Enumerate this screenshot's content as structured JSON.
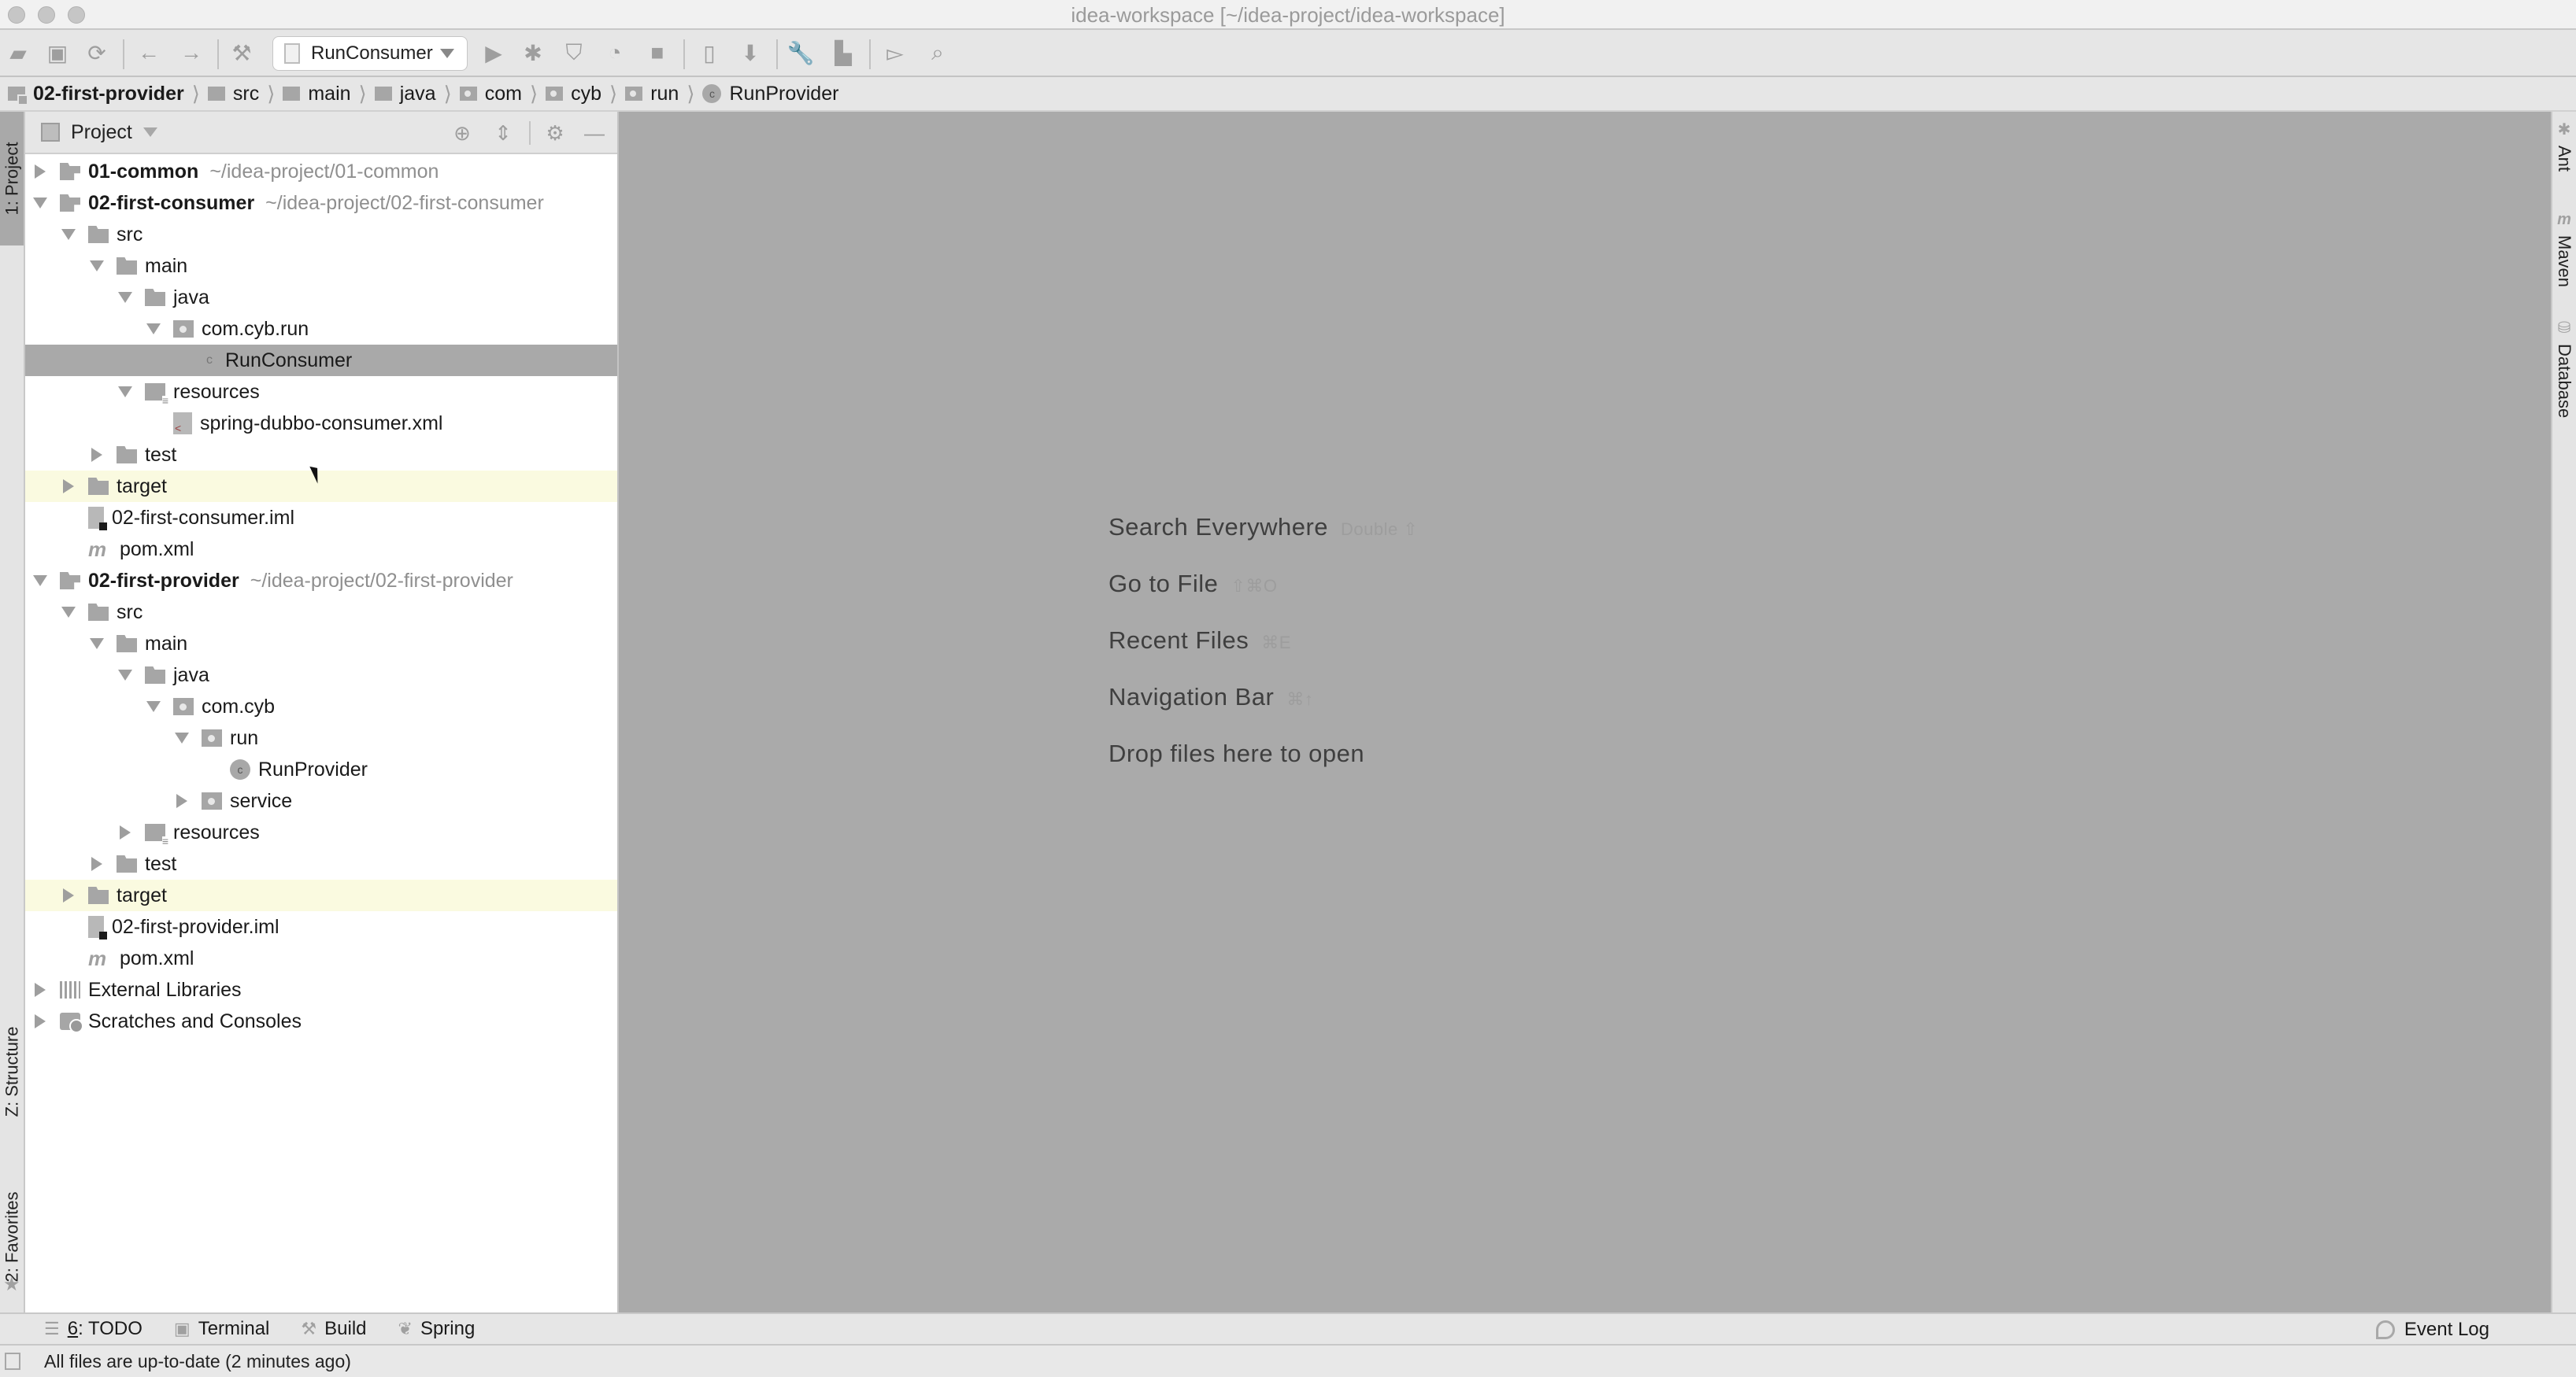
{
  "window": {
    "title": "idea-workspace [~/idea-project/idea-workspace]"
  },
  "toolbar": {
    "run_config": "RunConsumer",
    "icons": [
      "open-folder-icon",
      "save-icon",
      "sync-icon",
      "back-arrow-icon",
      "forward-arrow-icon",
      "build-hammer-icon",
      "run-icon",
      "debug-icon",
      "run-with-coverage-icon",
      "profile-icon",
      "stop-icon",
      "device-manager-icon",
      "sdk-manager-icon",
      "settings-wrench-icon",
      "project-structure-icon",
      "terminal-panel-icon",
      "search-icon"
    ]
  },
  "navbar": {
    "crumbs": [
      {
        "label": "02-first-provider",
        "icon": "module-folder-icon"
      },
      {
        "label": "src",
        "icon": "folder-icon"
      },
      {
        "label": "main",
        "icon": "folder-icon"
      },
      {
        "label": "java",
        "icon": "folder-icon"
      },
      {
        "label": "com",
        "icon": "package-icon"
      },
      {
        "label": "cyb",
        "icon": "package-icon"
      },
      {
        "label": "run",
        "icon": "package-icon"
      },
      {
        "label": "RunProvider",
        "icon": "class-icon"
      }
    ]
  },
  "left_stripe": {
    "project": "1: Project",
    "structure": "Z: Structure",
    "favorites": "2: Favorites"
  },
  "right_stripe": {
    "ant": "Ant",
    "maven": "Maven",
    "database": "Database"
  },
  "project_panel": {
    "title": "Project",
    "tree": [
      {
        "label": "01-common",
        "path": "~/idea-project/01-common",
        "level": 0,
        "toggle": "closed",
        "icon": "module",
        "bold": true
      },
      {
        "label": "02-first-consumer",
        "path": "~/idea-project/02-first-consumer",
        "level": 0,
        "toggle": "open",
        "icon": "module",
        "bold": true
      },
      {
        "label": "src",
        "level": 1,
        "toggle": "open",
        "icon": "folder"
      },
      {
        "label": "main",
        "level": 2,
        "toggle": "open",
        "icon": "folder"
      },
      {
        "label": "java",
        "level": 3,
        "toggle": "open",
        "icon": "folder"
      },
      {
        "label": "com.cyb.run",
        "level": 4,
        "toggle": "open",
        "icon": "pkg"
      },
      {
        "label": "RunConsumer",
        "level": 5,
        "toggle": "none",
        "icon": "cls-small",
        "selected": true
      },
      {
        "label": "resources",
        "level": 3,
        "toggle": "open",
        "icon": "res"
      },
      {
        "label": "spring-dubbo-consumer.xml",
        "level": 4,
        "toggle": "none",
        "icon": "xml"
      },
      {
        "label": "test",
        "level": 2,
        "toggle": "closed",
        "icon": "folder"
      },
      {
        "label": "target",
        "level": 1,
        "toggle": "closed",
        "icon": "folder",
        "excluded": true
      },
      {
        "label": "02-first-consumer.iml",
        "level": 1,
        "toggle": "none",
        "icon": "iml"
      },
      {
        "label": "pom.xml",
        "level": 1,
        "toggle": "none",
        "icon": "maven"
      },
      {
        "label": "02-first-provider",
        "path": "~/idea-project/02-first-provider",
        "level": 0,
        "toggle": "open",
        "icon": "module",
        "bold": true
      },
      {
        "label": "src",
        "level": 1,
        "toggle": "open",
        "icon": "folder"
      },
      {
        "label": "main",
        "level": 2,
        "toggle": "open",
        "icon": "folder"
      },
      {
        "label": "java",
        "level": 3,
        "toggle": "open",
        "icon": "folder"
      },
      {
        "label": "com.cyb",
        "level": 4,
        "toggle": "open",
        "icon": "pkg"
      },
      {
        "label": "run",
        "level": 5,
        "toggle": "open",
        "icon": "pkg"
      },
      {
        "label": "RunProvider",
        "level": 6,
        "toggle": "none",
        "icon": "cls"
      },
      {
        "label": "service",
        "level": 5,
        "toggle": "closed",
        "icon": "pkg"
      },
      {
        "label": "resources",
        "level": 3,
        "toggle": "closed",
        "icon": "res"
      },
      {
        "label": "test",
        "level": 2,
        "toggle": "closed",
        "icon": "folder"
      },
      {
        "label": "target",
        "level": 1,
        "toggle": "closed",
        "icon": "folder",
        "excluded": true
      },
      {
        "label": "02-first-provider.iml",
        "level": 1,
        "toggle": "none",
        "icon": "iml"
      },
      {
        "label": "pom.xml",
        "level": 1,
        "toggle": "none",
        "icon": "maven"
      },
      {
        "label": "External Libraries",
        "level": 0,
        "toggle": "closed",
        "icon": "libs"
      },
      {
        "label": "Scratches and Consoles",
        "level": 0,
        "toggle": "closed",
        "icon": "scratch"
      }
    ]
  },
  "editor": {
    "hints": [
      {
        "label": "Search Everywhere",
        "shortcut": "Double ⇧"
      },
      {
        "label": "Go to File",
        "shortcut": "⇧⌘O"
      },
      {
        "label": "Recent Files",
        "shortcut": "⌘E"
      },
      {
        "label": "Navigation Bar",
        "shortcut": "⌘↑"
      },
      {
        "label": "Drop files here to open",
        "shortcut": ""
      }
    ]
  },
  "bottom_tools": {
    "todo_num": "6",
    "todo": ": TODO",
    "terminal": "Terminal",
    "build": "Build",
    "spring": "Spring",
    "event_log": "Event Log"
  },
  "status": {
    "message": "All files are up-to-date (2 minutes ago)"
  }
}
